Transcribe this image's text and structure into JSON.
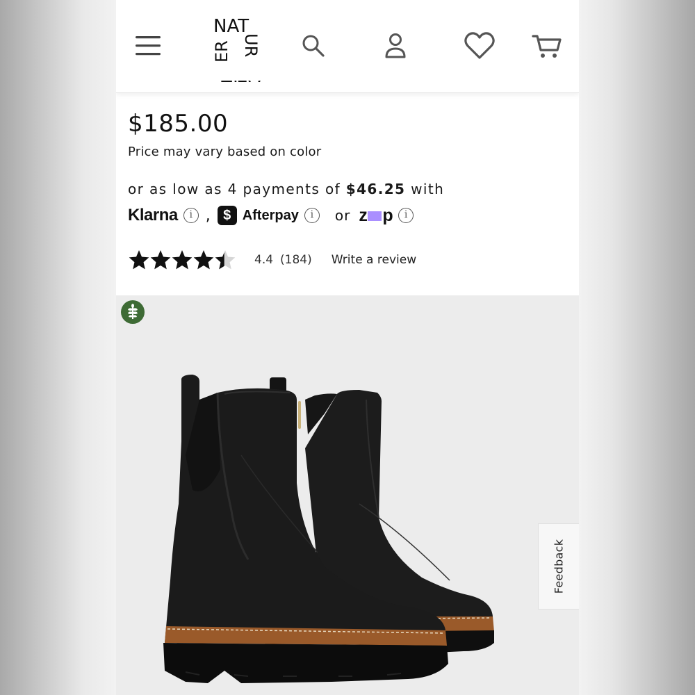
{
  "header": {
    "logo_text": "NATURALIZER",
    "icons": [
      "menu-icon",
      "search-icon",
      "account-icon",
      "heart-icon",
      "cart-icon"
    ]
  },
  "product": {
    "price": "$185.00",
    "price_note": "Price may vary based on color",
    "installments": {
      "prefix": "or as low as 4 payments of",
      "amount": "$46.25",
      "suffix": "with",
      "klarna": "Klarna",
      "comma": ",",
      "afterpay_badge": "$",
      "afterpay": "Afterpay",
      "or": "or",
      "zip_z": "z",
      "zip_p": "p",
      "info_glyph": "i"
    },
    "rating": {
      "stars": 4.4,
      "value": "4.4",
      "count": "(184)",
      "write_review": "Write a review"
    }
  },
  "feedback_label": "Feedback",
  "colors": {
    "zip_accent": "#aa8fff",
    "eco_badge": "#3e6b35"
  }
}
